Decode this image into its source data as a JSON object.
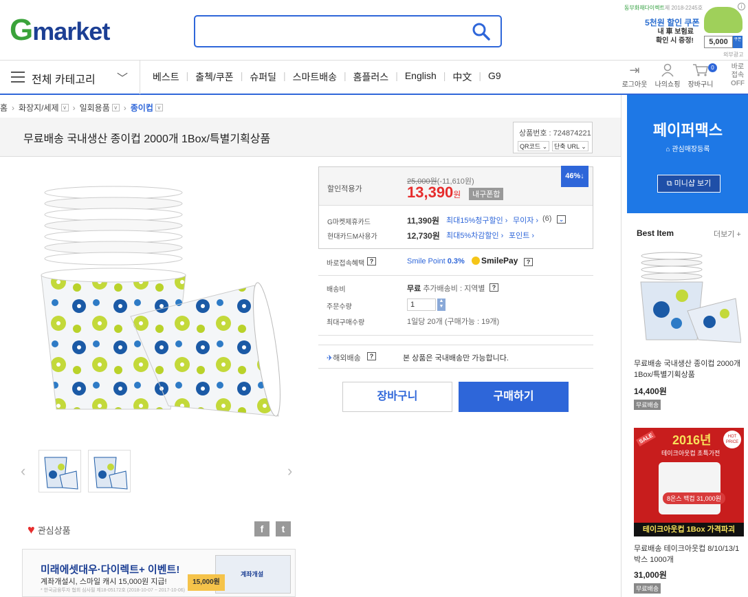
{
  "header": {
    "logo_g": "G",
    "logo_market": "market",
    "ad": {
      "brand": "동부화재다이렉트",
      "brand_sub": "제 2018-2245호",
      "title": "5천원 할인 쿠폰",
      "line1": "내 車 보험료",
      "line2": "확인 시 증정!",
      "price": "5,000",
      "coupon": "쿠폰",
      "label": "외부광고",
      "close": "i"
    }
  },
  "nav": {
    "category_label": "전체 카테고리",
    "menu": [
      "베스트",
      "출첵/쿠폰",
      "슈퍼딜",
      "스마트배송",
      "홈플러스",
      "English",
      "中文",
      "G9"
    ],
    "icons": [
      {
        "icon": "logout-icon",
        "label": "로그아웃"
      },
      {
        "icon": "user-icon",
        "label": "나의쇼핑"
      },
      {
        "icon": "cart-icon",
        "label": "장바구니"
      }
    ],
    "cart_count": "0",
    "baro": [
      "바로",
      "접속"
    ],
    "baro_state": "OFF"
  },
  "breadcrumb": {
    "home": "홈",
    "items": [
      "화장지/세제",
      "일회용품",
      "종이컵"
    ]
  },
  "product": {
    "title": "무료배송 국내생산 종이컵 2000개 1Box/특별기획상품",
    "number_label": "상품번호 : 724874221",
    "qr": "QR코드",
    "short_url": "단축 URL",
    "discount_label": "할인적용가",
    "original_price": "25,000원",
    "discount_amount": "(-11,610원)",
    "sale_price": "13,390",
    "won": "원",
    "included": "내구폰합",
    "discount_badge": "46%↓",
    "card1_label": "G마켓제휴카드",
    "card1_price": "11,390원",
    "card1_detail": "최대15%청구할인",
    "card1_extra": "무이자",
    "card1_count": "(6)",
    "card2_label": "현대카드M사용가",
    "card2_price": "12,730원",
    "card2_detail": "최대5%차감할인",
    "card2_extra": "포인트",
    "benefit_label": "바로접속혜택",
    "smile_point": "Smile Point",
    "smile_pct": "0.3%",
    "smile_pay": "SmilePay",
    "ship_label": "배송비",
    "ship_free": "무료",
    "ship_extra": "추가배송비 : 지역별",
    "qty_label": "주문수량",
    "qty_value": "1",
    "max_label": "최대구매수량",
    "max_value": "1일당 20개 (구매가능 : 19개)",
    "overseas_label": "해외배송",
    "overseas_value": "본 상품은 국내배송만 가능합니다.",
    "cart_btn": "장바구니",
    "buy_btn": "구매하기",
    "fav_label": "관심상품"
  },
  "bottom_ad": {
    "title": "미래에셋대우·다이렉트+ 이벤트!",
    "sub": "계좌개설시, 스마일 캐시 15,000원 지급!",
    "tiny": "* 한국금융투자 협회 심사필 제18-05172호 (2018-10-07 ~ 2017-10-06)",
    "coupon": "15,000원",
    "screen": "계좌개설"
  },
  "sidebar": {
    "shop_name": "페이퍼맥스",
    "register": "관심매장등록",
    "minishop_btn": "미니샵 보기",
    "best_label": "Best Item",
    "more_label": "더보기 +",
    "items": [
      {
        "name": "무료배송 국내생산 종이컵 2000개 1Box/특별기획상품",
        "price": "14,400원",
        "tag": "무료배송"
      },
      {
        "name": "무료배송 테이크아웃컵 8/10/13/1박스 1000개",
        "price": "31,000원",
        "tag": "무료배송"
      }
    ],
    "promo": {
      "year": "2016년",
      "sub": "테이크아웃컵 초특가전",
      "ribbon": "8온스 백컵 31,000원",
      "bar": "테이크아웃컵 1Box 가격파괴",
      "sale": "SALE",
      "hot": "HOT PRICE"
    }
  }
}
